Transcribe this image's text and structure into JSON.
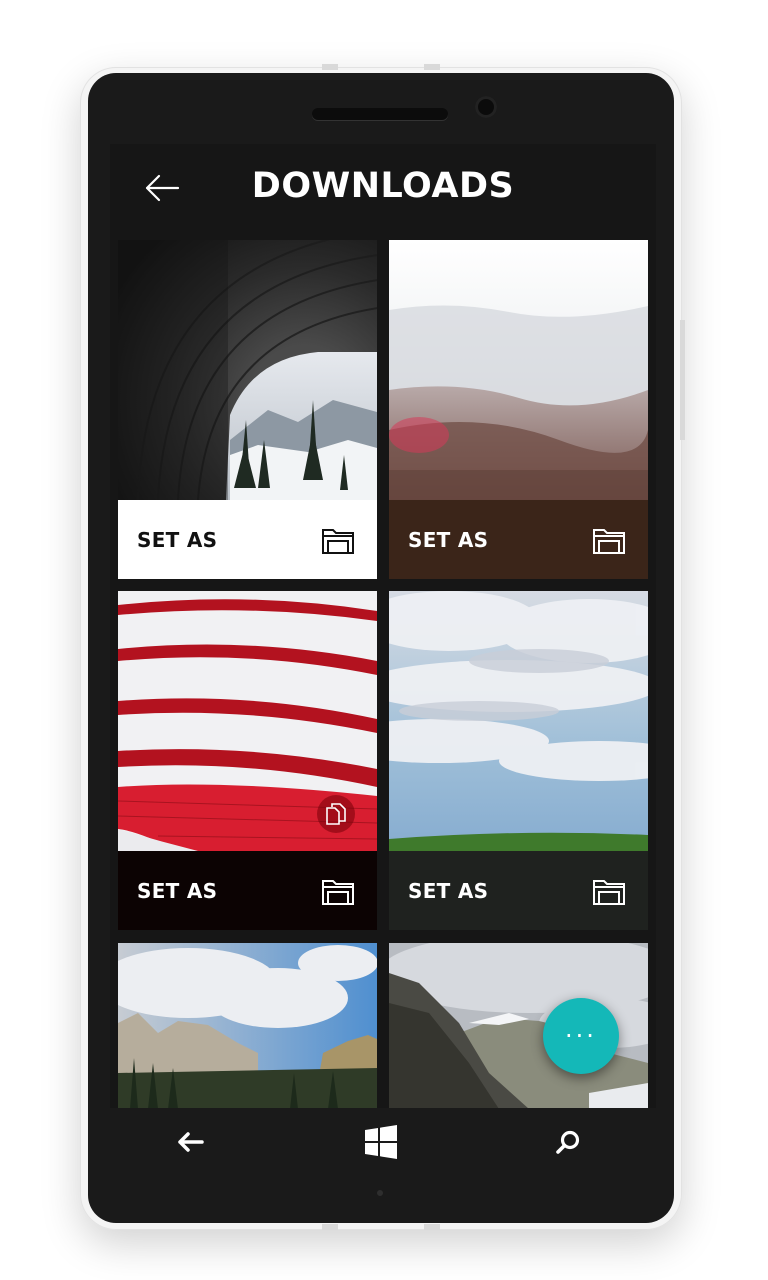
{
  "header": {
    "title": "DOWNLOADS",
    "back_icon": "arrow-left-icon"
  },
  "cards": [
    {
      "scene": "tunnel-snow-forest",
      "label": "SET AS",
      "bar_color": "#ffffff",
      "label_color": "#111111",
      "icon": "folder-icon"
    },
    {
      "scene": "misty-mountains",
      "label": "SET AS",
      "bar_color": "#3b2519",
      "label_color": "#ffffff",
      "icon": "folder-icon"
    },
    {
      "scene": "red-white-stripes",
      "label": "SET AS",
      "bar_color": "#0c0303",
      "label_color": "#ffffff",
      "icon": "folder-icon",
      "overlay_icon": "copy-files-icon"
    },
    {
      "scene": "cloudy-sky-field",
      "label": "SET AS",
      "bar_color": "#1f221f",
      "label_color": "#ffffff",
      "icon": "folder-icon"
    },
    {
      "scene": "yosemite-valley"
    },
    {
      "scene": "half-dome-cliffs"
    }
  ],
  "fab": {
    "label": "···",
    "color": "#14b8b8"
  },
  "nav": {
    "back_icon": "back-arrow-icon",
    "home_icon": "windows-logo-icon",
    "search_icon": "search-icon"
  }
}
